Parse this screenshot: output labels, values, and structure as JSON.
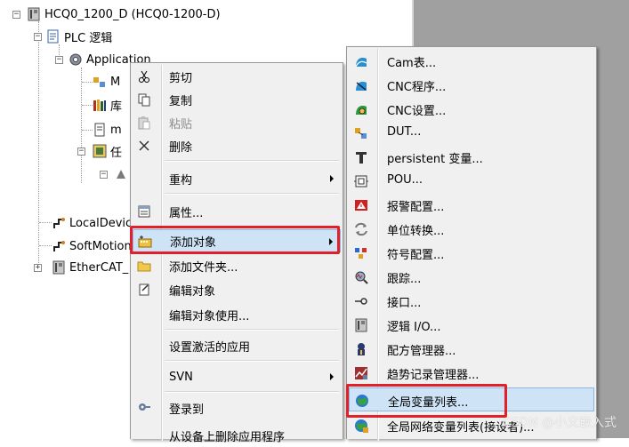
{
  "tree": {
    "root": "HCQ0_1200_D (HCQ0-1200-D)",
    "plc_logic": "PLC 逻辑",
    "application": "Application",
    "child_m": "M",
    "child_lib": "库",
    "child_ma": "m",
    "child_task": "任",
    "local_device": "LocalDevic",
    "softmotion": "SoftMotion",
    "ethercat": "EtherCAT_"
  },
  "context_menu": {
    "items": [
      {
        "label": "剪切",
        "icon": "scissors-icon",
        "enabled": true
      },
      {
        "label": "复制",
        "icon": "copy-icon",
        "enabled": true
      },
      {
        "label": "粘贴",
        "icon": "paste-icon",
        "enabled": false
      },
      {
        "label": "删除",
        "icon": "delete-icon",
        "enabled": true
      },
      {
        "label": "重构",
        "icon": "",
        "enabled": true,
        "submenu": true
      },
      {
        "label": "属性...",
        "icon": "properties-icon",
        "enabled": true
      },
      {
        "label": "添加对象",
        "icon": "add-object-icon",
        "enabled": true,
        "submenu": true,
        "highlighted": true
      },
      {
        "label": "添加文件夹...",
        "icon": "folder-icon",
        "enabled": true
      },
      {
        "label": "编辑对象",
        "icon": "edit-object-icon",
        "enabled": true
      },
      {
        "label": "编辑对象使用...",
        "icon": "",
        "enabled": true
      },
      {
        "label": "设置激活的应用",
        "icon": "",
        "enabled": true
      },
      {
        "label": "SVN",
        "icon": "",
        "enabled": true,
        "submenu": true
      },
      {
        "label": "登录到",
        "icon": "login-icon",
        "enabled": true
      },
      {
        "label": "从设备上删除应用程序",
        "icon": "",
        "enabled": true
      }
    ]
  },
  "submenu": {
    "items": [
      {
        "label": "Cam表...",
        "icon": "cam-table-icon"
      },
      {
        "label": "CNC程序...",
        "icon": "cnc-program-icon"
      },
      {
        "label": "CNC设置...",
        "icon": "cnc-settings-icon"
      },
      {
        "label": "DUT...",
        "icon": "dut-icon"
      },
      {
        "label": "persistent 变量...",
        "icon": "persistent-var-icon"
      },
      {
        "label": "POU...",
        "icon": "pou-icon"
      },
      {
        "label": "报警配置...",
        "icon": "alarm-config-icon"
      },
      {
        "label": "单位转换...",
        "icon": "unit-conversion-icon"
      },
      {
        "label": "符号配置...",
        "icon": "symbol-config-icon"
      },
      {
        "label": "跟踪...",
        "icon": "trace-icon"
      },
      {
        "label": "接口...",
        "icon": "interface-icon"
      },
      {
        "label": "逻辑 I/O...",
        "icon": "logic-io-icon"
      },
      {
        "label": "配方管理器...",
        "icon": "recipe-manager-icon"
      },
      {
        "label": "趋势记录管理器...",
        "icon": "trend-recorder-icon"
      },
      {
        "label": "全局变量列表...",
        "icon": "global-var-list-icon",
        "highlighted": true
      },
      {
        "label": "全局网络变量列表(接设者)...",
        "icon": "network-var-list-icon"
      }
    ]
  },
  "watermark": "CSDN @小义嵌入式"
}
